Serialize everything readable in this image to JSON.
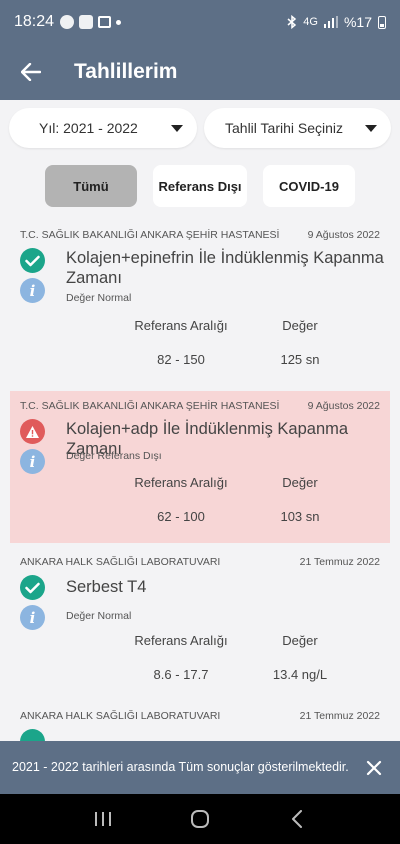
{
  "status_bar": {
    "time": "18:24",
    "network": "4G",
    "battery": "%17"
  },
  "header": {
    "title": "Tahlillerim"
  },
  "filters": {
    "year": "Yıl: 2021 - 2022",
    "date": "Tahlil Tarihi Seçiniz"
  },
  "tabs": [
    {
      "label": "Tümü",
      "active": true
    },
    {
      "label": "Referans Dışı",
      "active": false
    },
    {
      "label": "COVID-19",
      "active": false
    }
  ],
  "labels": {
    "reference_range": "Referans Aralığı",
    "value": "Değer"
  },
  "results": [
    {
      "lab": "T.C. SAĞLIK BAKANLIĞI ANKARA ŞEHİR HASTANESİ",
      "date": "9 Ağustos 2022",
      "test": "Kolajen+epinefrin İle İndüklenmiş Kapanma Zamanı",
      "status": "Değer Normal",
      "reference": "82 - 150",
      "value": "125 sn"
    },
    {
      "lab": "T.C. SAĞLIK BAKANLIĞI ANKARA ŞEHİR HASTANESİ",
      "date": "9 Ağustos 2022",
      "test": "Kolajen+adp İle İndüklenmiş Kapanma Zamanı",
      "status": "Değer Referans Dışı",
      "reference": "62 - 100",
      "value": "103 sn"
    },
    {
      "lab": "ANKARA HALK SAĞLIĞI LABORATUVARI",
      "date": "21 Temmuz 2022",
      "test": "Serbest T4",
      "status": "Değer Normal",
      "reference": "8.6 - 17.7",
      "value": "13.4 ng/L"
    },
    {
      "lab": "ANKARA HALK SAĞLIĞI LABORATUVARI",
      "date": "21 Temmuz 2022"
    }
  ],
  "snackbar": {
    "message": "2021 - 2022 tarihleri arasında Tüm sonuçlar gösterilmektedir."
  },
  "colors": {
    "primary": "#5d6f86",
    "normal": "#1ba58a",
    "alert": "#e05b5b",
    "alert_bg": "#f7d6d6",
    "info": "#8cb5e0"
  }
}
